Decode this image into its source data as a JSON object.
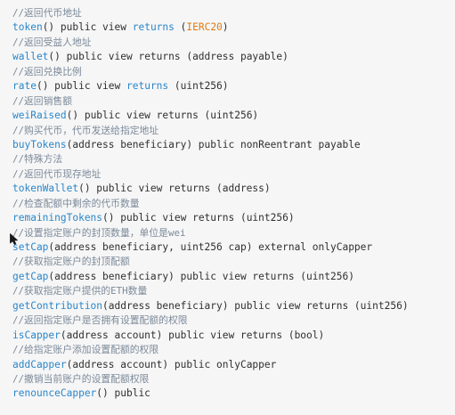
{
  "lines": [
    {
      "type": "comment",
      "text": "//返回代币地址"
    },
    {
      "type": "code",
      "parts": [
        {
          "c": "fn",
          "t": "token"
        },
        {
          "c": "plain",
          "t": "() public view "
        },
        {
          "c": "kw",
          "t": "returns"
        },
        {
          "c": "plain",
          "t": " ("
        },
        {
          "c": "ty",
          "t": "IERC20"
        },
        {
          "c": "plain",
          "t": ")"
        }
      ]
    },
    {
      "type": "comment",
      "text": "//返回受益人地址"
    },
    {
      "type": "code",
      "parts": [
        {
          "c": "fn",
          "t": "wallet"
        },
        {
          "c": "plain",
          "t": "() public view returns (address payable)"
        }
      ]
    },
    {
      "type": "comment",
      "text": "//返回兑换比例"
    },
    {
      "type": "code",
      "parts": [
        {
          "c": "fn",
          "t": "rate"
        },
        {
          "c": "plain",
          "t": "() public view "
        },
        {
          "c": "kw",
          "t": "returns"
        },
        {
          "c": "plain",
          "t": " (uint256)"
        }
      ]
    },
    {
      "type": "comment",
      "text": "//返回销售额"
    },
    {
      "type": "code",
      "parts": [
        {
          "c": "fn",
          "t": "weiRaised"
        },
        {
          "c": "plain",
          "t": "() public view returns (uint256)"
        }
      ]
    },
    {
      "type": "comment",
      "text": "//购买代币，代币发送给指定地址"
    },
    {
      "type": "code",
      "parts": [
        {
          "c": "fn",
          "t": "buyTokens"
        },
        {
          "c": "plain",
          "t": "(address beneficiary) public nonReentrant payable"
        }
      ]
    },
    {
      "type": "comment",
      "text": "//特殊方法"
    },
    {
      "type": "comment",
      "text": "//返回代币现存地址"
    },
    {
      "type": "code",
      "parts": [
        {
          "c": "fn",
          "t": "tokenWallet"
        },
        {
          "c": "plain",
          "t": "() public view returns (address)"
        }
      ]
    },
    {
      "type": "comment",
      "text": "//检查配额中剩余的代币数量"
    },
    {
      "type": "code",
      "parts": [
        {
          "c": "fn",
          "t": "remainingTokens"
        },
        {
          "c": "plain",
          "t": "() public view returns (uint256)"
        }
      ]
    },
    {
      "type": "comment",
      "text": "//设置指定账户的封顶数量，单位是wei"
    },
    {
      "type": "code",
      "parts": [
        {
          "c": "fn",
          "t": "setCap"
        },
        {
          "c": "plain",
          "t": "(address beneficiary, uint256 cap) external onlyCapper"
        }
      ]
    },
    {
      "type": "comment",
      "text": "//获取指定账户的封顶配额"
    },
    {
      "type": "code",
      "parts": [
        {
          "c": "fn",
          "t": "getCap"
        },
        {
          "c": "plain",
          "t": "(address beneficiary) public view returns (uint256)"
        }
      ]
    },
    {
      "type": "comment",
      "text": "//获取指定账户提供的ETH数量"
    },
    {
      "type": "code",
      "parts": [
        {
          "c": "fn",
          "t": "getContribution"
        },
        {
          "c": "plain",
          "t": "(address beneficiary) public view returns (uint256)"
        }
      ]
    },
    {
      "type": "comment",
      "text": "//返回指定账户是否拥有设置配额的权限"
    },
    {
      "type": "code",
      "parts": [
        {
          "c": "fn",
          "t": "isCapper"
        },
        {
          "c": "plain",
          "t": "(address account) public view returns (bool)"
        }
      ]
    },
    {
      "type": "comment",
      "text": "//给指定账户添加设置配额的权限"
    },
    {
      "type": "code",
      "parts": [
        {
          "c": "fn",
          "t": "addCapper"
        },
        {
          "c": "plain",
          "t": "(address account) public onlyCapper"
        }
      ]
    },
    {
      "type": "comment",
      "text": "//撤销当前账户的设置配额权限"
    },
    {
      "type": "code",
      "parts": [
        {
          "c": "fn",
          "t": "renounceCapper"
        },
        {
          "c": "plain",
          "t": "() public"
        }
      ]
    }
  ],
  "cursor_icon": "mouse-pointer-icon",
  "colors": {
    "background": "#f6f6f6",
    "function_name": "#2a86c9",
    "keyword": "#2a86c9",
    "type": "#e07b14",
    "comment": "#7c8a9a",
    "text": "#2f2f2f"
  }
}
